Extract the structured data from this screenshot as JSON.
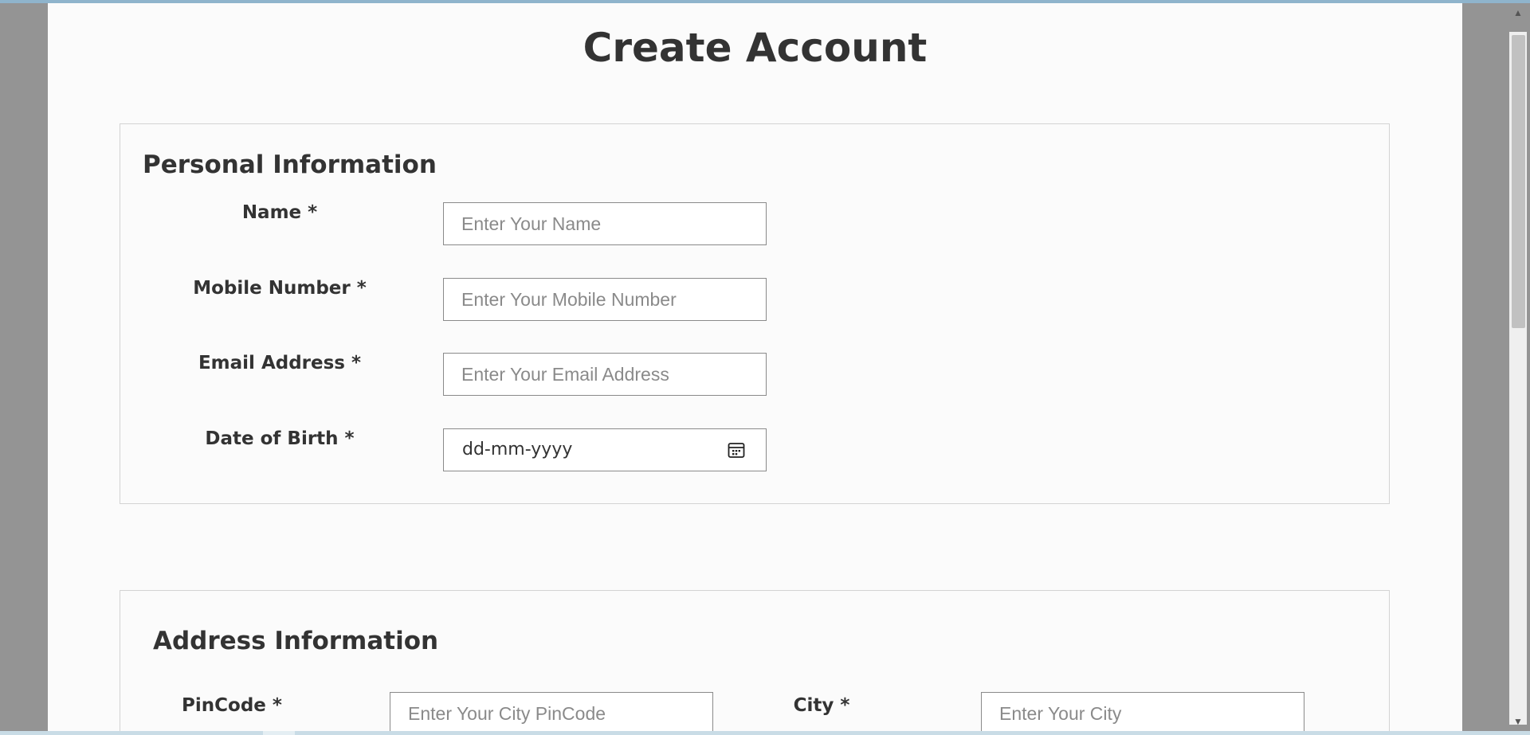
{
  "page": {
    "title": "Create Account"
  },
  "personal": {
    "title": "Personal Information",
    "fields": {
      "name": {
        "label": "Name *",
        "placeholder": "Enter Your Name"
      },
      "mobile": {
        "label": "Mobile Number *",
        "placeholder": "Enter Your Mobile Number"
      },
      "email": {
        "label": "Email Address *",
        "placeholder": "Enter Your Email Address"
      },
      "dob": {
        "label": "Date of Birth *",
        "value": "dd-mm-yyyy",
        "icon": "calendar-icon"
      }
    }
  },
  "address": {
    "title": "Address Information",
    "fields": {
      "pincode": {
        "label": "PinCode *",
        "placeholder": "Enter Your City PinCode"
      },
      "city": {
        "label": "City *",
        "placeholder": "Enter Your City"
      }
    }
  },
  "scrollbar": {
    "up_icon": "arrow-up-icon",
    "down_icon": "arrow-down-icon"
  }
}
